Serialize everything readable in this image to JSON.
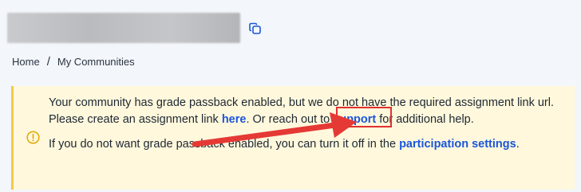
{
  "header": {
    "title_redacted": true,
    "copy_icon": "copy-icon"
  },
  "breadcrumb": {
    "items": [
      "Home",
      "My Communities"
    ],
    "separator": "/"
  },
  "alert": {
    "icon": "warning-circle-icon",
    "accent_color": "#f2c94c",
    "background_color": "#fff8dc",
    "link_color": "#1a56db",
    "p1_before": "Your community has grade passback enabled, but we do not have the required assignment link url. Please create an assignment link ",
    "p1_link_here": "here",
    "p1_middle": ". Or reach out to ",
    "p1_link_support": "support",
    "p1_after": " for additional help.",
    "p2_before": "If you do not want grade passback enabled, you can turn it off in the ",
    "p2_link": "participation settings",
    "p2_after": "."
  },
  "annotation": {
    "arrow_color": "#e53935",
    "box_color": "#e03131"
  }
}
